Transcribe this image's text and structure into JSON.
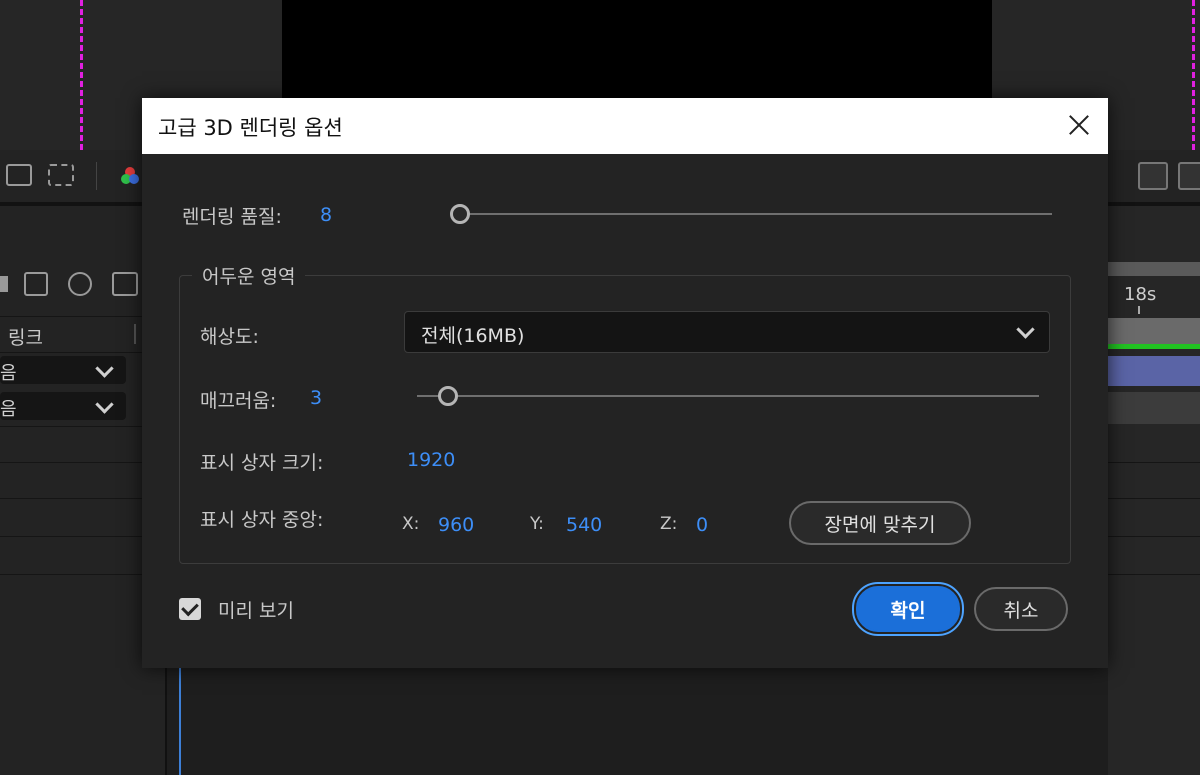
{
  "background": {
    "panel_rows": [
      {
        "label": "링크"
      },
      {
        "value": "음"
      },
      {
        "value": "음"
      }
    ],
    "timeline_marker": "18s"
  },
  "dialog": {
    "title": "고급 3D 렌더링 옵션",
    "quality": {
      "label": "렌더링 품질:",
      "value": "8",
      "level": 0.0
    },
    "group": {
      "legend": "어두운 영역",
      "resolution": {
        "label": "해상도:",
        "selected": "전체(16MB)"
      },
      "smoothness": {
        "label": "매끄러움:",
        "value": "3",
        "level": 0.05
      },
      "box_size": {
        "label": "표시 상자 크기:",
        "value": "1920"
      },
      "box_center": {
        "label": "표시 상자 중앙:",
        "x_label": "X:",
        "x": "960",
        "y_label": "Y:",
        "y": "540",
        "z_label": "Z:",
        "z": "0",
        "fit_button": "장면에 맞추기"
      }
    },
    "preview": {
      "label": "미리 보기",
      "checked": true
    },
    "ok_button": "확인",
    "cancel_button": "취소"
  },
  "colors": {
    "accent": "#1b6fd9",
    "value_text": "#3d8ef7",
    "guide": "#e020e0",
    "playhead_bar": "#22c322",
    "clip": "#5a64a6"
  }
}
